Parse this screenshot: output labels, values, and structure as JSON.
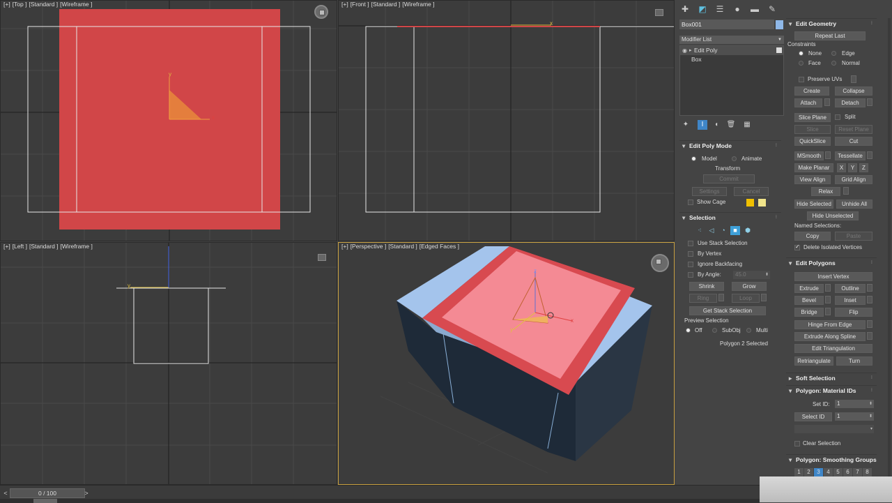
{
  "viewports": {
    "top": {
      "plus": "[+]",
      "view": "[Top ]",
      "shading": "[Standard ]",
      "mode": "[Wireframe ]"
    },
    "front": {
      "plus": "[+]",
      "view": "[Front ]",
      "shading": "[Standard ]",
      "mode": "[Wireframe ]"
    },
    "left": {
      "plus": "[+]",
      "view": "[Left ]",
      "shading": "[Standard ]",
      "mode": "[Wireframe ]"
    },
    "perspective": {
      "plus": "[+]",
      "view": "[Perspective ]",
      "shading": "[Standard ]",
      "mode": "[Edged Faces ]"
    }
  },
  "axes": {
    "x": "x",
    "y": "y",
    "z": "z"
  },
  "timeline": {
    "value": "0 / 100",
    "prev": "<",
    "next": ">"
  },
  "toolbar_icons": [
    "create-icon",
    "modify-icon",
    "hierarchy-icon",
    "motion-icon",
    "display-icon",
    "utilities-icon"
  ],
  "object": {
    "name": "Box001",
    "color": "#8fb8e8"
  },
  "modifier_list": {
    "label": "Modifier List"
  },
  "stack": {
    "items": [
      "Edit Poly",
      "Box"
    ]
  },
  "edit_poly_mode": {
    "title": "Edit Poly Mode",
    "model": "Model",
    "animate": "Animate",
    "transform": "Transform",
    "commit": "Commit",
    "settings": "Settings",
    "cancel": "Cancel",
    "show_cage": "Show Cage",
    "cage_colors": [
      "#f0c000",
      "#f0e48a"
    ]
  },
  "selection": {
    "title": "Selection",
    "use_stack": "Use Stack Selection",
    "by_vertex": "By Vertex",
    "ignore_backfacing": "Ignore Backfacing",
    "by_angle": "By Angle:",
    "angle_value": "45.0",
    "shrink": "Shrink",
    "grow": "Grow",
    "ring": "Ring",
    "loop": "Loop",
    "get_stack": "Get Stack Selection",
    "preview": "Preview Selection",
    "off": "Off",
    "subobj": "SubObj",
    "multi": "Multi",
    "status": "Polygon 2 Selected"
  },
  "edit_geometry": {
    "title": "Edit Geometry",
    "repeat_last": "Repeat Last",
    "constraints": "Constraints",
    "none": "None",
    "edge": "Edge",
    "face": "Face",
    "normal": "Normal",
    "preserve_uvs": "Preserve UVs",
    "create": "Create",
    "collapse": "Collapse",
    "attach": "Attach",
    "detach": "Detach",
    "slice_plane": "Slice Plane",
    "split": "Split",
    "slice": "Slice",
    "reset_plane": "Reset Plane",
    "quickslice": "QuickSlice",
    "cut": "Cut",
    "msmooth": "MSmooth",
    "tessellate": "Tessellate",
    "make_planar": "Make Planar",
    "x": "X",
    "y": "Y",
    "z": "Z",
    "view_align": "View Align",
    "grid_align": "Grid Align",
    "relax": "Relax",
    "hide_selected": "Hide Selected",
    "unhide_all": "Unhide All",
    "hide_unselected": "Hide Unselected",
    "named_selections": "Named Selections:",
    "copy": "Copy",
    "paste": "Paste",
    "delete_isolated": "Delete Isolated Vertices"
  },
  "edit_polygons": {
    "title": "Edit Polygons",
    "insert_vertex": "Insert Vertex",
    "extrude": "Extrude",
    "outline": "Outline",
    "bevel": "Bevel",
    "inset": "Inset",
    "bridge": "Bridge",
    "flip": "Flip",
    "hinge": "Hinge From Edge",
    "extrude_spline": "Extrude Along Spline",
    "edit_triangulation": "Edit Triangulation",
    "retriangulate": "Retriangulate",
    "turn": "Turn"
  },
  "soft_selection": {
    "title": "Soft Selection"
  },
  "material_ids": {
    "title": "Polygon: Material IDs",
    "set_id": "Set ID:",
    "set_value": "1",
    "select_id": "Select ID",
    "select_value": "1",
    "clear_selection": "Clear Selection"
  },
  "smoothing_groups": {
    "title": "Polygon: Smoothing Groups",
    "groups": [
      "1",
      "2",
      "3",
      "4",
      "5",
      "6",
      "7",
      "8"
    ]
  }
}
